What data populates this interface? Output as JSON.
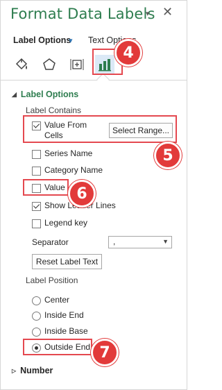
{
  "pane": {
    "title": "Format Data Labels",
    "close": "✕",
    "menu_arrow": "▾"
  },
  "tabs": {
    "label_options": "Label Options",
    "chevron": "▾",
    "text_options": "Text Options"
  },
  "icons": [
    "fill-line-icon",
    "effects-icon",
    "size-properties-icon",
    "label-options-icon"
  ],
  "label_options": {
    "section_title": "Label Options",
    "contains_heading": "Label Contains",
    "checkboxes": [
      {
        "label": "Value From\nCells",
        "checked": true
      },
      {
        "label": "Series Name",
        "checked": false
      },
      {
        "label": "Category Name",
        "checked": false
      },
      {
        "label": "Value",
        "checked": false
      },
      {
        "label": "Show Leader Lines",
        "checked": true
      },
      {
        "label": "Legend key",
        "checked": false
      }
    ],
    "select_range_button": "Select Range...",
    "separator_label": "Separator",
    "separator_value": ",",
    "reset_button": "Reset Label Text",
    "position_heading": "Label Position",
    "positions": [
      {
        "label": "Center",
        "selected": false
      },
      {
        "label": "Inside End",
        "selected": false
      },
      {
        "label": "Inside Base",
        "selected": false
      },
      {
        "label": "Outside End",
        "selected": true
      }
    ]
  },
  "number_section": {
    "title": "Number"
  },
  "callouts": [
    "4",
    "5",
    "6",
    "7"
  ],
  "colors": {
    "accent": "#2e7d4f",
    "highlight": "#e4484f",
    "badge": "#e23a3a",
    "active_tab": "#2e7d4f"
  }
}
